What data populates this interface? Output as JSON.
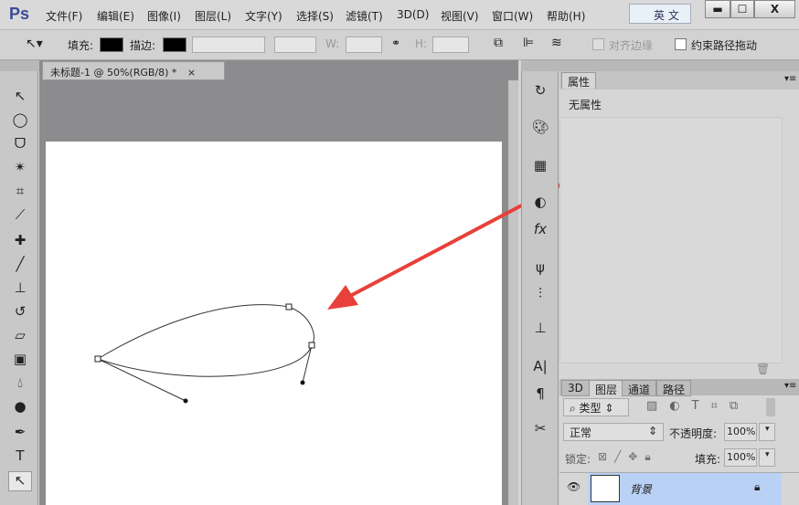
{
  "app": {
    "logo": "Ps",
    "menus": [
      "文件(F)",
      "编辑(E)",
      "图像(I)",
      "图层(L)",
      "文字(Y)",
      "选择(S)",
      "滤镜(T)",
      "3D(D)",
      "视图(V)",
      "窗口(W)",
      "帮助(H)"
    ],
    "ime": "英 文",
    "win": [
      "▬",
      "☐",
      "X"
    ]
  },
  "options": {
    "fill": "填充:",
    "stroke": "描边:",
    "w": "W:",
    "h": "H:",
    "align_edges": "对齐边缘",
    "constrain": "约束路径拖动",
    "fill_color": "#000000",
    "stroke_color": "#000000"
  },
  "doc": {
    "tab": "未标题-1 @ 50%(RGB/8) *",
    "close": "×"
  },
  "properties": {
    "tab": "属性",
    "empty": "无属性"
  },
  "layers": {
    "tabs": [
      "3D",
      "图层",
      "通道",
      "路径"
    ],
    "filter": "类型",
    "blend": "正常",
    "opacity_label": "不透明度:",
    "opacity": "100%",
    "lock_label": "锁定:",
    "fill_label": "填充:",
    "fill": "100%",
    "layer_name": "背景"
  },
  "colors": {
    "arrow": "#e8403a",
    "selected_layer": "#b9d1f5"
  }
}
